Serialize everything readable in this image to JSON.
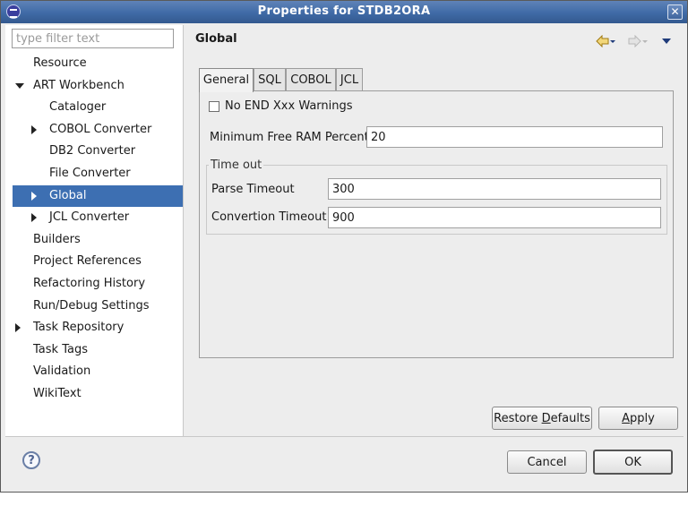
{
  "window": {
    "title": "Properties for STDB2ORA",
    "close_glyph": "✕"
  },
  "filter": {
    "placeholder": "type filter text",
    "value": ""
  },
  "tree": [
    {
      "label": "Resource",
      "level": 0,
      "expander": "none",
      "selected": false
    },
    {
      "label": "ART Workbench",
      "level": 0,
      "expander": "expanded",
      "selected": false
    },
    {
      "label": "Cataloger",
      "level": 1,
      "expander": "none",
      "selected": false
    },
    {
      "label": "COBOL Converter",
      "level": 1,
      "expander": "collapsed",
      "selected": false
    },
    {
      "label": "DB2 Converter",
      "level": 1,
      "expander": "none",
      "selected": false
    },
    {
      "label": "File Converter",
      "level": 1,
      "expander": "none",
      "selected": false
    },
    {
      "label": "Global",
      "level": 1,
      "expander": "collapsed",
      "selected": true
    },
    {
      "label": "JCL Converter",
      "level": 1,
      "expander": "collapsed",
      "selected": false
    },
    {
      "label": "Builders",
      "level": 0,
      "expander": "none",
      "selected": false
    },
    {
      "label": "Project References",
      "level": 0,
      "expander": "none",
      "selected": false
    },
    {
      "label": "Refactoring History",
      "level": 0,
      "expander": "none",
      "selected": false
    },
    {
      "label": "Run/Debug Settings",
      "level": 0,
      "expander": "none",
      "selected": false
    },
    {
      "label": "Task Repository",
      "level": 0,
      "expander": "collapsed",
      "selected": false
    },
    {
      "label": "Task Tags",
      "level": 0,
      "expander": "none",
      "selected": false
    },
    {
      "label": "Validation",
      "level": 0,
      "expander": "none",
      "selected": false
    },
    {
      "label": "WikiText",
      "level": 0,
      "expander": "none",
      "selected": false
    }
  ],
  "page": {
    "title": "Global"
  },
  "nav_icons": {
    "back": "back-arrow-icon",
    "forward": "forward-arrow-icon",
    "menu": "view-menu-icon"
  },
  "tabs": [
    {
      "label": "General",
      "active": true
    },
    {
      "label": "SQL",
      "active": false
    },
    {
      "label": "COBOL",
      "active": false
    },
    {
      "label": "JCL",
      "active": false
    }
  ],
  "general": {
    "no_end_warnings": {
      "label": "No END Xxx Warnings",
      "checked": false
    },
    "min_free_ram": {
      "label": "Minimum Free RAM Percent",
      "value": "20"
    },
    "timeout_group": {
      "title": "Time out",
      "parse": {
        "label": "Parse Timeout",
        "value": "300"
      },
      "convertion": {
        "label": "Convertion Timeout",
        "value": "900"
      }
    }
  },
  "buttons": {
    "restore_defaults": {
      "prefix": "Restore ",
      "mnemonic": "D",
      "suffix": "efaults"
    },
    "apply": {
      "mnemonic": "A",
      "suffix": "pply"
    },
    "cancel": "Cancel",
    "ok": "OK"
  },
  "help": {
    "glyph": "?"
  }
}
